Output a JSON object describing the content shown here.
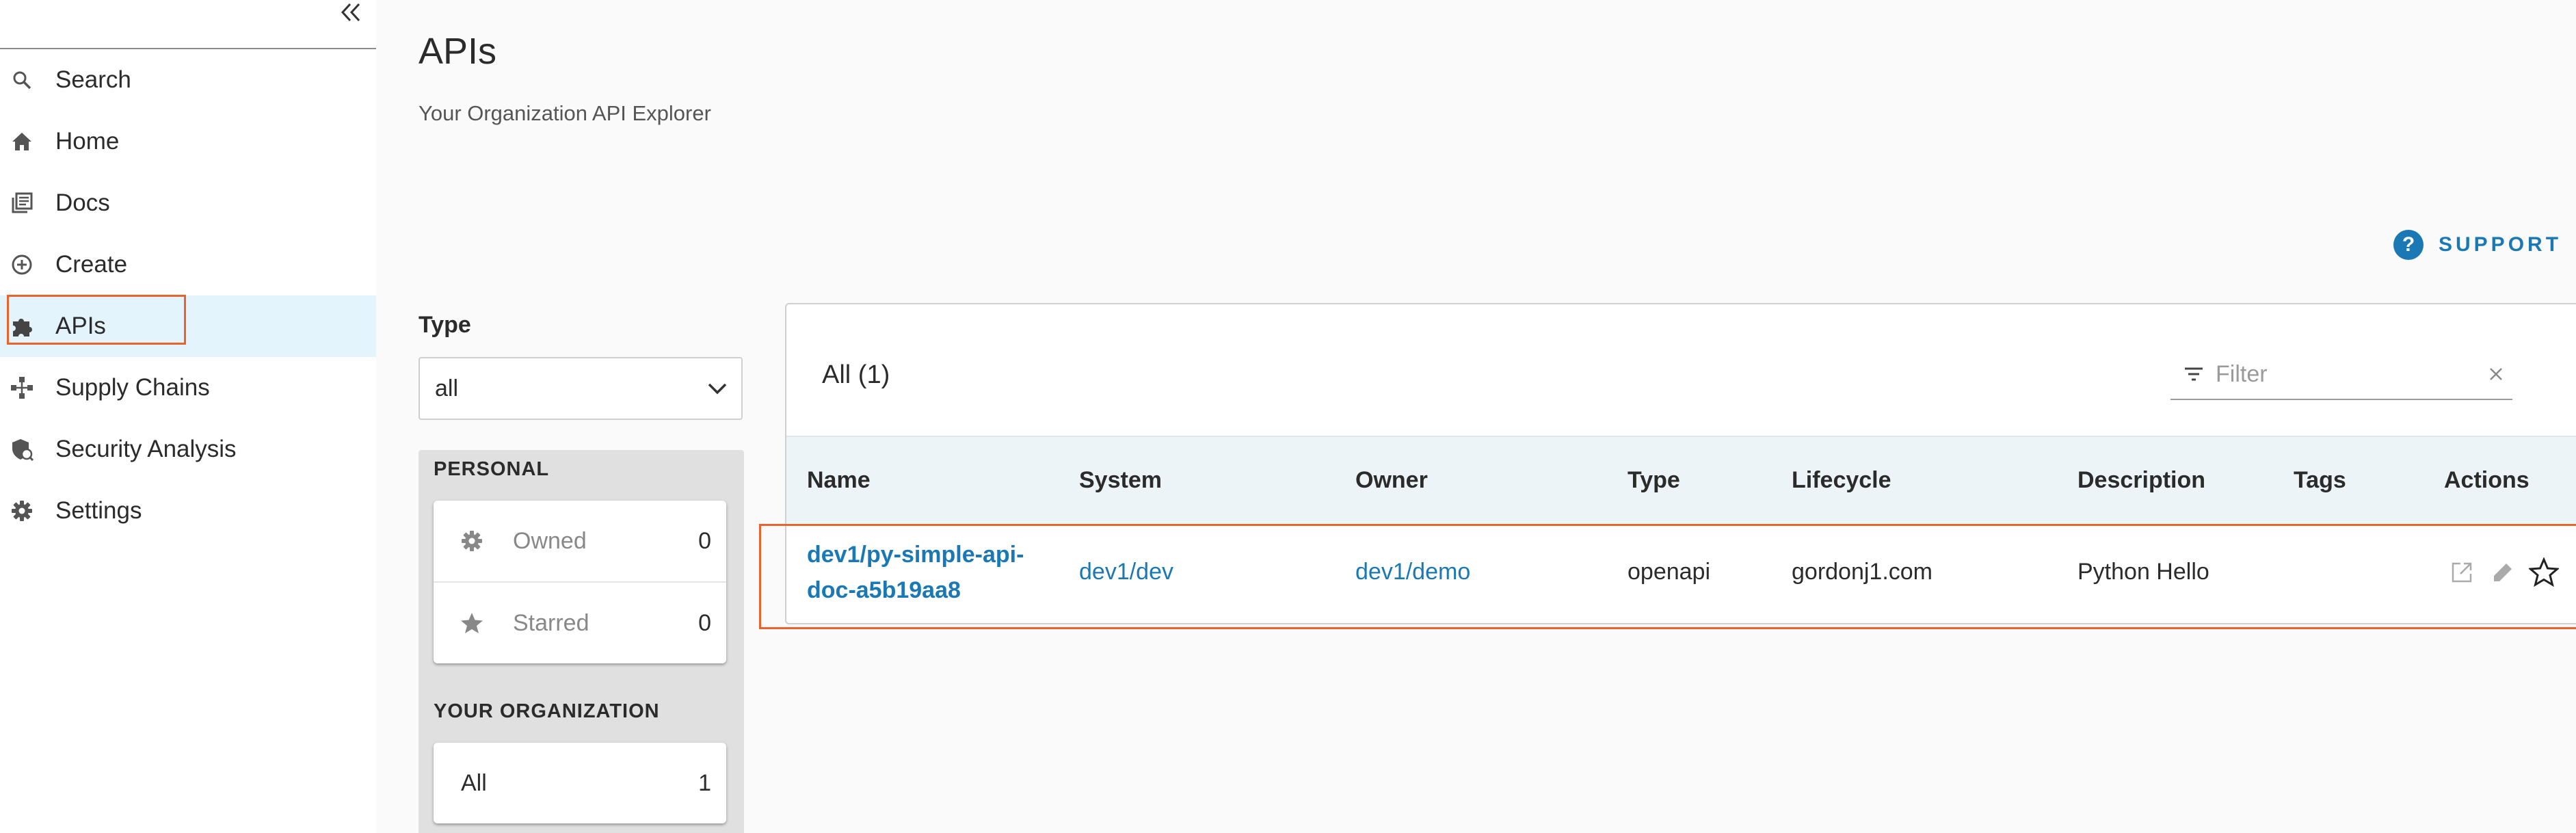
{
  "sidebar": {
    "items": [
      {
        "label": "Search",
        "icon": "search-icon"
      },
      {
        "label": "Home",
        "icon": "home-icon"
      },
      {
        "label": "Docs",
        "icon": "docs-icon"
      },
      {
        "label": "Create",
        "icon": "create-icon"
      },
      {
        "label": "APIs",
        "icon": "puzzle-icon",
        "active": true
      },
      {
        "label": "Supply Chains",
        "icon": "supply-chain-icon"
      },
      {
        "label": "Security Analysis",
        "icon": "security-shield-icon"
      },
      {
        "label": "Settings",
        "icon": "gear-icon"
      }
    ]
  },
  "header": {
    "title": "APIs",
    "subtitle": "Your Organization API Explorer",
    "support_label": "SUPPORT"
  },
  "filters": {
    "type_label": "Type",
    "type_value": "all",
    "personal_heading": "PERSONAL",
    "personal": [
      {
        "label": "Owned",
        "count": "0",
        "icon": "gear-icon"
      },
      {
        "label": "Starred",
        "count": "0",
        "icon": "star-icon"
      }
    ],
    "org_heading": "YOUR ORGANIZATION",
    "org": [
      {
        "label": "All",
        "count": "1"
      }
    ]
  },
  "table": {
    "title": "All (1)",
    "filter_placeholder": "Filter",
    "columns": [
      "Name",
      "System",
      "Owner",
      "Type",
      "Lifecycle",
      "Description",
      "Tags",
      "Actions"
    ],
    "rows": [
      {
        "name_line1": "dev1/py-simple-api-",
        "name_line2": "doc-a5b19aa8",
        "system": "dev1/dev",
        "owner": "dev1/demo",
        "type": "openapi",
        "lifecycle": "gordonj1.com",
        "description": "Python Hello",
        "tags": ""
      }
    ]
  },
  "colors": {
    "accent": "#1a79b4",
    "active_bg": "#e3f4fc",
    "highlight": "#e8642c"
  }
}
